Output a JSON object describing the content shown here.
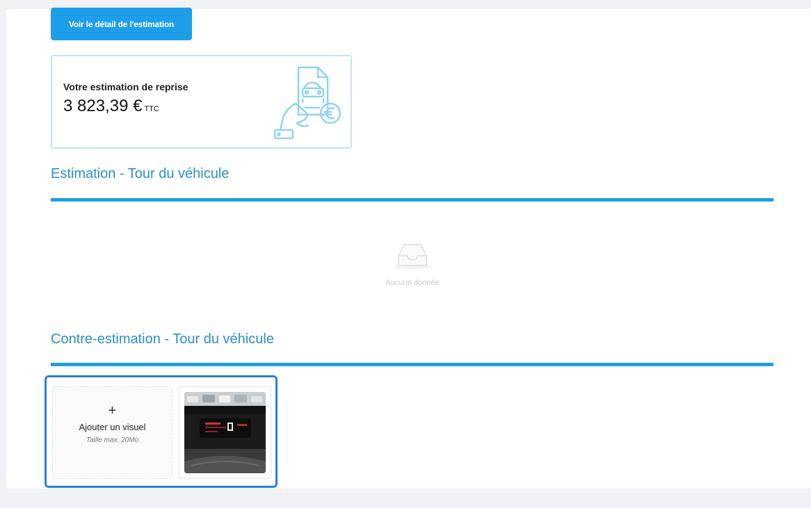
{
  "actions": {
    "detail_button_label": "Voir le détail de l'estimation"
  },
  "estimate": {
    "label": "Votre estimation de reprise",
    "amount": "3 823,39 €",
    "suffix": "TTC",
    "illustration_icon": "hand-document-car-euro-icon"
  },
  "sections": [
    {
      "title": "Estimation - Tour du véhicule",
      "empty_text": "Aucune donnée",
      "empty_icon": "empty-inbox-icon"
    },
    {
      "title": "Contre-estimation - Tour du véhicule"
    }
  ],
  "upload": {
    "plus": "+",
    "label": "Ajouter un visuel",
    "hint": "Taille max. 20Mo",
    "thumbnail_icon": "dashboard-photo-icon"
  },
  "colors": {
    "accent": "#1e9ee8",
    "rule": "#1ba0e1",
    "title": "#2a8fc8",
    "upload_border": "#2f7fd1",
    "card_border": "#bfe4f5"
  }
}
